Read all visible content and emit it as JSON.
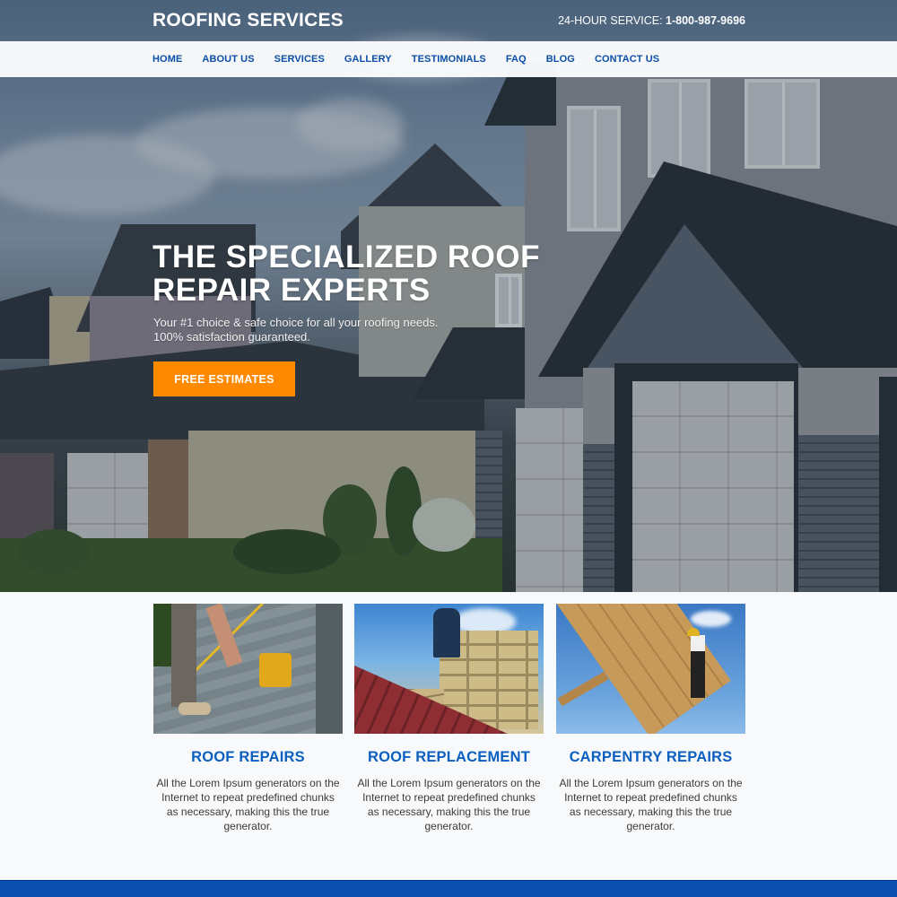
{
  "header": {
    "brand": "ROOFING SERVICES",
    "phone_label": "24-HOUR SERVICE: ",
    "phone_number": "1-800-987-9696"
  },
  "nav": {
    "items": [
      {
        "label": "HOME"
      },
      {
        "label": "ABOUT US"
      },
      {
        "label": "SERVICES"
      },
      {
        "label": "GALLERY"
      },
      {
        "label": "TESTIMONIALS"
      },
      {
        "label": "FAQ"
      },
      {
        "label": "BLOG"
      },
      {
        "label": "CONTACT US"
      }
    ]
  },
  "hero": {
    "title_line1": "THE SPECIALIZED ROOF",
    "title_line2": "REPAIR EXPERTS",
    "subtitle_line1": "Your #1 choice & safe choice for all your roofing needs.",
    "subtitle_line2": "100% satisfaction guaranteed.",
    "cta_label": "FREE ESTIMATES",
    "background_image": "houses-with-garages-photo"
  },
  "services": [
    {
      "title": "ROOF REPAIRS",
      "image": "roofer-with-nail-gun-photo",
      "description": "All the Lorem Ipsum generators on the Internet to repeat predefined chunks as necessary, making this the true generator."
    },
    {
      "title": "ROOF REPLACEMENT",
      "image": "worker-installing-metal-roof-photo",
      "description": "All the Lorem Ipsum generators on the Internet to repeat predefined chunks as necessary, making this the true generator."
    },
    {
      "title": "CARPENTRY REPAIRS",
      "image": "carpenter-on-roof-frame-photo",
      "description": "All the Lorem Ipsum generators on the Internet to repeat predefined chunks as necessary, making this the true generator."
    }
  ],
  "colors": {
    "nav_text": "#0b4fa8",
    "accent_orange": "#ff8a00",
    "service_title_blue": "#0b5fc0",
    "footer_blue": "#0a4eb0"
  }
}
